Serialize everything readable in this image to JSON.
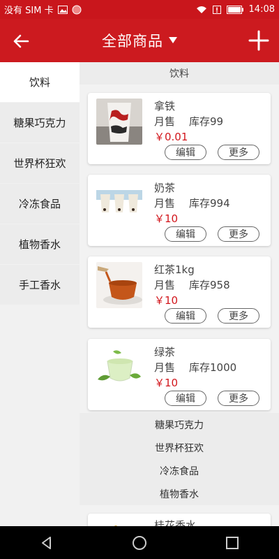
{
  "status_bar": {
    "carrier": "没有 SIM 卡",
    "time": "14:08"
  },
  "app_bar": {
    "title": "全部商品",
    "back_icon": "arrow-left-icon",
    "add_icon": "plus-icon",
    "dropdown_icon": "triangle-down-icon"
  },
  "sidebar": {
    "items": [
      {
        "label": "饮料",
        "active": true
      },
      {
        "label": "糖果巧克力",
        "active": false
      },
      {
        "label": "世界杯狂欢",
        "active": false
      },
      {
        "label": "冷冻食品",
        "active": false
      },
      {
        "label": "植物香水",
        "active": false
      },
      {
        "label": "手工香水",
        "active": false
      }
    ]
  },
  "content": {
    "section_title": "饮料",
    "products": [
      {
        "name": "拿铁",
        "sales_label": "月售",
        "stock": "库存99",
        "price": "￥0.01",
        "edit": "编辑",
        "more": "更多"
      },
      {
        "name": "奶茶",
        "sales_label": "月售",
        "stock": "库存994",
        "price": "￥10",
        "edit": "编辑",
        "more": "更多"
      },
      {
        "name": "红茶1kg",
        "sales_label": "月售",
        "stock": "库存958",
        "price": "￥10",
        "edit": "编辑",
        "more": "更多"
      },
      {
        "name": "绿茶",
        "sales_label": "月售",
        "stock": "库存1000",
        "price": "￥10",
        "edit": "编辑",
        "more": "更多"
      }
    ],
    "other_categories": [
      "糖果巧克力",
      "世界杯狂欢",
      "冷冻食品",
      "植物香水"
    ],
    "partial_product_name": "桂花香水"
  },
  "colors": {
    "primary": "#cc1a1f",
    "price": "#d2161c"
  }
}
